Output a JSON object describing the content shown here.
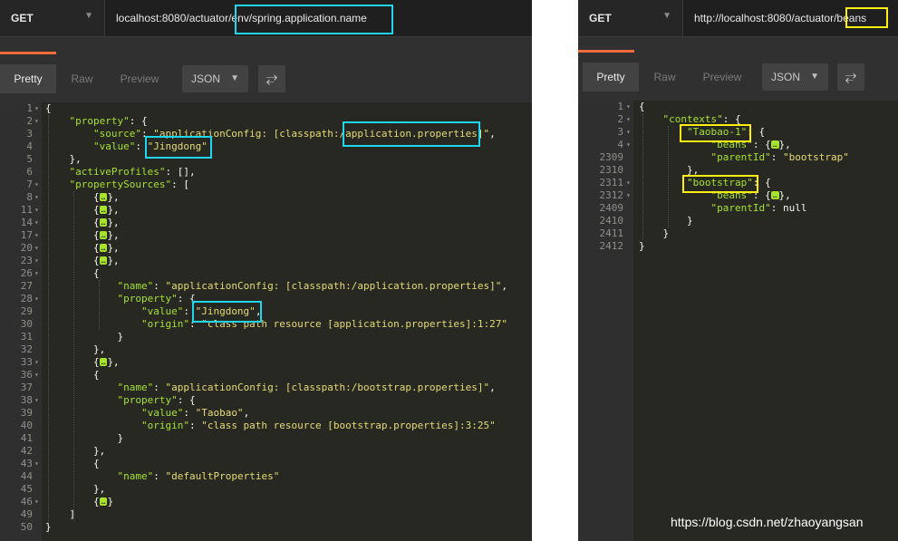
{
  "left": {
    "method": "GET",
    "url": "localhost:8080/actuator/env/spring.application.name",
    "tabs": [
      "Pretty",
      "Raw",
      "Preview"
    ],
    "format": "JSON",
    "lines": [
      {
        "n": "1",
        "f": true,
        "t": [
          [
            "p",
            "{"
          ]
        ]
      },
      {
        "n": "2",
        "f": true,
        "t": [
          [
            "p",
            "    "
          ],
          [
            "k",
            "\"property\""
          ],
          [
            "p",
            ": {"
          ]
        ]
      },
      {
        "n": "3",
        "t": [
          [
            "p",
            "        "
          ],
          [
            "k",
            "\"source\""
          ],
          [
            "p",
            ": "
          ],
          [
            "s",
            "\"applicationConfig: [classpath:/application.properties]\""
          ],
          [
            "p",
            ","
          ]
        ]
      },
      {
        "n": "4",
        "t": [
          [
            "p",
            "        "
          ],
          [
            "k",
            "\"value\""
          ],
          [
            "p",
            ": "
          ],
          [
            "s",
            "\"Jingdong\""
          ]
        ]
      },
      {
        "n": "5",
        "t": [
          [
            "p",
            "    },"
          ]
        ]
      },
      {
        "n": "6",
        "t": [
          [
            "p",
            "    "
          ],
          [
            "k",
            "\"activeProfiles\""
          ],
          [
            "p",
            ": [],"
          ]
        ]
      },
      {
        "n": "7",
        "f": true,
        "t": [
          [
            "p",
            "    "
          ],
          [
            "k",
            "\"propertySources\""
          ],
          [
            "p",
            ": ["
          ]
        ]
      },
      {
        "n": "8",
        "f": true,
        "t": [
          [
            "p",
            "        {"
          ],
          [
            "c",
            "…"
          ],
          [
            "p",
            "},"
          ]
        ]
      },
      {
        "n": "11",
        "f": true,
        "t": [
          [
            "p",
            "        {"
          ],
          [
            "c",
            "…"
          ],
          [
            "p",
            "},"
          ]
        ]
      },
      {
        "n": "14",
        "f": true,
        "t": [
          [
            "p",
            "        {"
          ],
          [
            "c",
            "…"
          ],
          [
            "p",
            "},"
          ]
        ]
      },
      {
        "n": "17",
        "f": true,
        "t": [
          [
            "p",
            "        {"
          ],
          [
            "c",
            "…"
          ],
          [
            "p",
            "},"
          ]
        ]
      },
      {
        "n": "20",
        "f": true,
        "t": [
          [
            "p",
            "        {"
          ],
          [
            "c",
            "…"
          ],
          [
            "p",
            "},"
          ]
        ]
      },
      {
        "n": "23",
        "f": true,
        "t": [
          [
            "p",
            "        {"
          ],
          [
            "c",
            "…"
          ],
          [
            "p",
            "},"
          ]
        ]
      },
      {
        "n": "26",
        "f": true,
        "t": [
          [
            "p",
            "        {"
          ]
        ]
      },
      {
        "n": "27",
        "t": [
          [
            "p",
            "            "
          ],
          [
            "k",
            "\"name\""
          ],
          [
            "p",
            ": "
          ],
          [
            "s",
            "\"applicationConfig: [classpath:/application.properties]\""
          ],
          [
            "p",
            ","
          ]
        ]
      },
      {
        "n": "28",
        "f": true,
        "t": [
          [
            "p",
            "            "
          ],
          [
            "k",
            "\"property\""
          ],
          [
            "p",
            ": {"
          ]
        ]
      },
      {
        "n": "29",
        "t": [
          [
            "p",
            "                "
          ],
          [
            "k",
            "\"value\""
          ],
          [
            "p",
            ": "
          ],
          [
            "s",
            "\"Jingdong\""
          ],
          [
            "p",
            ","
          ]
        ]
      },
      {
        "n": "30",
        "t": [
          [
            "p",
            "                "
          ],
          [
            "k",
            "\"origin\""
          ],
          [
            "p",
            ": "
          ],
          [
            "s",
            "\"class path resource [application.properties]:1:27\""
          ]
        ]
      },
      {
        "n": "31",
        "t": [
          [
            "p",
            "            }"
          ]
        ]
      },
      {
        "n": "32",
        "t": [
          [
            "p",
            "        },"
          ]
        ]
      },
      {
        "n": "33",
        "f": true,
        "t": [
          [
            "p",
            "        {"
          ],
          [
            "c",
            "…"
          ],
          [
            "p",
            "},"
          ]
        ]
      },
      {
        "n": "36",
        "f": true,
        "t": [
          [
            "p",
            "        {"
          ]
        ]
      },
      {
        "n": "37",
        "t": [
          [
            "p",
            "            "
          ],
          [
            "k",
            "\"name\""
          ],
          [
            "p",
            ": "
          ],
          [
            "s",
            "\"applicationConfig: [classpath:/bootstrap.properties]\""
          ],
          [
            "p",
            ","
          ]
        ]
      },
      {
        "n": "38",
        "f": true,
        "t": [
          [
            "p",
            "            "
          ],
          [
            "k",
            "\"property\""
          ],
          [
            "p",
            ": {"
          ]
        ]
      },
      {
        "n": "39",
        "t": [
          [
            "p",
            "                "
          ],
          [
            "k",
            "\"value\""
          ],
          [
            "p",
            ": "
          ],
          [
            "s",
            "\"Taobao\""
          ],
          [
            "p",
            ","
          ]
        ]
      },
      {
        "n": "40",
        "t": [
          [
            "p",
            "                "
          ],
          [
            "k",
            "\"origin\""
          ],
          [
            "p",
            ": "
          ],
          [
            "s",
            "\"class path resource [bootstrap.properties]:3:25\""
          ]
        ]
      },
      {
        "n": "41",
        "t": [
          [
            "p",
            "            }"
          ]
        ]
      },
      {
        "n": "42",
        "t": [
          [
            "p",
            "        },"
          ]
        ]
      },
      {
        "n": "43",
        "f": true,
        "t": [
          [
            "p",
            "        {"
          ]
        ]
      },
      {
        "n": "44",
        "t": [
          [
            "p",
            "            "
          ],
          [
            "k",
            "\"name\""
          ],
          [
            "p",
            ": "
          ],
          [
            "s",
            "\"defaultProperties\""
          ]
        ]
      },
      {
        "n": "45",
        "t": [
          [
            "p",
            "        },"
          ]
        ]
      },
      {
        "n": "46",
        "f": true,
        "t": [
          [
            "p",
            "        {"
          ],
          [
            "c",
            "…"
          ],
          [
            "p",
            "}"
          ]
        ]
      },
      {
        "n": "49",
        "t": [
          [
            "p",
            "    ]"
          ]
        ]
      },
      {
        "n": "50",
        "t": [
          [
            "p",
            "}"
          ]
        ]
      }
    ]
  },
  "right": {
    "method": "GET",
    "url": "http://localhost:8080/actuator/beans",
    "tabs": [
      "Pretty",
      "Raw",
      "Preview"
    ],
    "format": "JSON",
    "lines": [
      {
        "n": "1",
        "f": true,
        "t": [
          [
            "p",
            "{"
          ]
        ]
      },
      {
        "n": "2",
        "f": true,
        "t": [
          [
            "p",
            "    "
          ],
          [
            "k",
            "\"contexts\""
          ],
          [
            "p",
            ": {"
          ]
        ]
      },
      {
        "n": "3",
        "f": true,
        "t": [
          [
            "p",
            "        "
          ],
          [
            "k",
            "\"Taobao-1\""
          ],
          [
            "p",
            ": {"
          ]
        ]
      },
      {
        "n": "4",
        "f": true,
        "t": [
          [
            "p",
            "            "
          ],
          [
            "k",
            "\"beans\""
          ],
          [
            "p",
            ": {"
          ],
          [
            "c",
            "…"
          ],
          [
            "p",
            "},"
          ]
        ]
      },
      {
        "n": "2309",
        "t": [
          [
            "p",
            "            "
          ],
          [
            "k",
            "\"parentId\""
          ],
          [
            "p",
            ": "
          ],
          [
            "s",
            "\"bootstrap\""
          ]
        ]
      },
      {
        "n": "2310",
        "t": [
          [
            "p",
            "        },"
          ]
        ]
      },
      {
        "n": "2311",
        "f": true,
        "t": [
          [
            "p",
            "        "
          ],
          [
            "k",
            "\"bootstrap\""
          ],
          [
            "p",
            ": {"
          ]
        ]
      },
      {
        "n": "2312",
        "f": true,
        "t": [
          [
            "p",
            "            "
          ],
          [
            "k",
            "\"beans\""
          ],
          [
            "p",
            ": {"
          ],
          [
            "c",
            "…"
          ],
          [
            "p",
            "},"
          ]
        ]
      },
      {
        "n": "2409",
        "t": [
          [
            "p",
            "            "
          ],
          [
            "k",
            "\"parentId\""
          ],
          [
            "p",
            ": null"
          ]
        ]
      },
      {
        "n": "2410",
        "t": [
          [
            "p",
            "        }"
          ]
        ]
      },
      {
        "n": "2411",
        "t": [
          [
            "p",
            "    }"
          ]
        ]
      },
      {
        "n": "2412",
        "t": [
          [
            "p",
            "}"
          ]
        ]
      }
    ]
  },
  "watermark": "https://blog.csdn.net/zhaoyangsan",
  "colors": {
    "key": "#a6e22e",
    "string": "#e6db74",
    "highlight_left": "#1fd6ee",
    "highlight_right": "#ffee11",
    "accent": "#f26b3a"
  }
}
